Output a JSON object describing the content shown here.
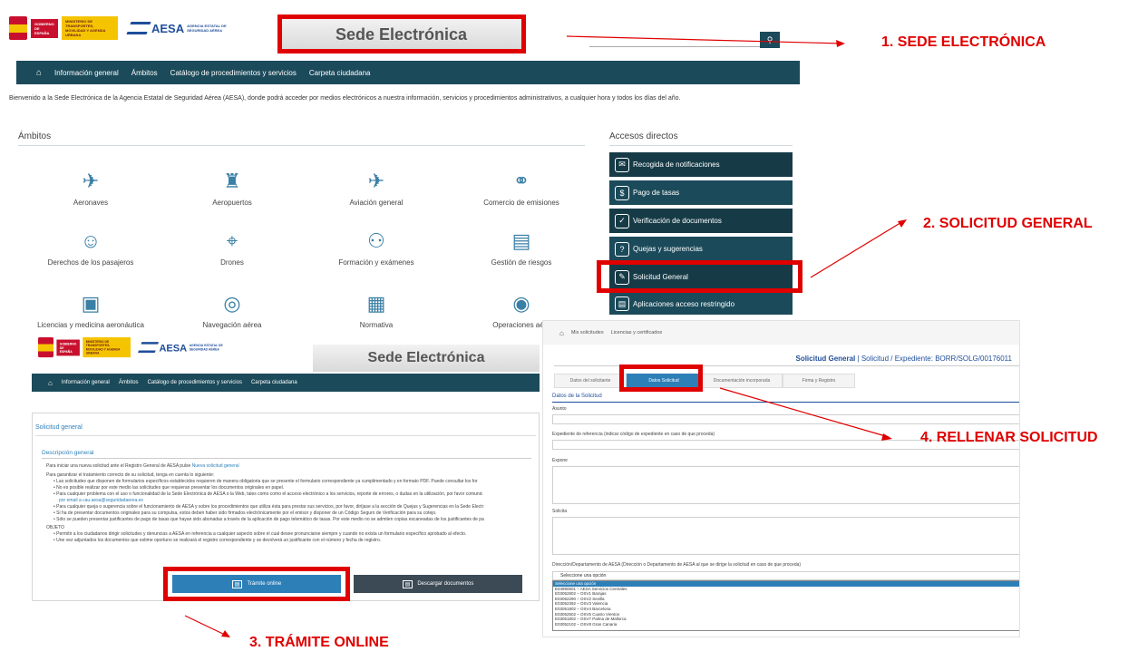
{
  "top": {
    "gov_text": "GOBIERNO DE ESPAÑA",
    "ministry_text": "MINISTERIO DE TRANSPORTES, MOVILIDAD Y AGENDA URBANA",
    "aesa": "AESA",
    "aesa_sub": "AGENCIA ESTATAL DE SEGURIDAD AÉREA",
    "banner": "Sede Electrónica",
    "nav": [
      "Información general",
      "Ámbitos",
      "Catálogo de procedimientos y servicios",
      "Carpeta ciudadana"
    ],
    "welcome": "Bienvenido a la Sede Electrónica de la Agencia Estatal de Seguridad Aérea (AESA), donde podrá acceder por medios electrónicos a nuestra información, servicios y procedimientos administrativos, a cualquier hora y todos los días del año.",
    "ambitos_title": "Ámbitos",
    "ambitos": [
      "Aeronaves",
      "Aeropuertos",
      "Aviación general",
      "Comercio de emisiones",
      "Derechos de los pasajeros",
      "Drones",
      "Formación y exámenes",
      "Gestión de riesgos",
      "Licencias y medicina aeronáutica",
      "Navegación aérea",
      "Normativa",
      "Operaciones aére"
    ],
    "accesos_title": "Accesos directos",
    "accesos": [
      "Recogida de notificaciones",
      "Pago de tasas",
      "Verificación de documentos",
      "Quejas y sugerencias",
      "Solicitud General",
      "Aplicaciones acceso restringido"
    ]
  },
  "annotations": {
    "a1": "1. SEDE ELECTRÓNICA",
    "a2": "2. SOLICITUD GENERAL",
    "a3": "3. TRÁMITE ONLINE",
    "a4": "4. RELLENAR SOLICITUD"
  },
  "bottom_left": {
    "title": "Solicitud general",
    "desc_title": "Descripción general",
    "intro_prefix": "Para iniciar una nueva solicitud ante el Registro General de AESA pulse",
    "intro_link": "Nueva solicitud general",
    "line2": "Para garantizar el tratamiento correcto de su solicitud, tenga en cuenta lo siguiente:",
    "bullets": [
      "Las solicitudes que disponen de formularios específicos establecidos requieren de manera obligatoria que se presente el formulario correspondiente ya cumplimentado y en formato PDF. Puede consultar los for",
      "No es posible realizar por este medio las solicitudes que requieran presentar los documentos originales en papel.",
      "Para cualquier problema con el uso o funcionalidad de la Sede Electrónica de AESA o la Web, tales como como el acceso electrónico a los servicios, reporte de errores, o dudas en la utilización, por favor comunic",
      "por email a cau.aesa@seguridadaerea.es",
      "Para cualquier queja o sugerencia sobre el funcionamiento de AESA y sobre los procedimientos que utiliza ésta para prestar sus servicios, por favor, diríjase a la sección de Quejas y Sugerencias en la Sede Electr",
      "Si ha de presentar documentos originales para su compulsa, estos deben haber sido firmados electrónicamente por el emisor y disponer de un Código Seguro de Verificación para su cotejo.",
      "Sólo se pueden presentar justificantes de pago de tasas que hayan sido abonadas a través de la aplicación de pago telemático de tasas. Por este medio no se admiten copias escaneadas de los justificantes de pa"
    ],
    "objeto": "OBJETO",
    "obj_bullets": [
      "Permitir a los ciudadanos dirigir solicitudes y denuncias a AESA en referencia a cualquier aspecto sobre el cual desee pronunciarse siempre y cuando no exista un formulario específico aprobado al efecto.",
      "Une vez adjuntados los documentos que estime oportuno se realizará el registro correspondiente y se devolverá un justificante con el número y fecha de registro."
    ],
    "btn_online": "Trámite online",
    "btn_download": "Descargar documentos"
  },
  "form": {
    "crumbs": [
      "Mis solicitudes",
      "Licencias y certificados"
    ],
    "heading_bold": "Solicitud General",
    "heading_rest": "| Solicitud / Expediente: BORR/SOLG/00176011",
    "steps": [
      "Datos del solicitante",
      "Datos Solicitud",
      "Documentación incorporada",
      "Firma y Registro"
    ],
    "section": "Datos de la Solicitud",
    "asunto": "Asunto",
    "expediente": "Expediente de referencia (indicar código de expediente en caso de que proceda)",
    "expone": "Expone",
    "solicita": "Solicita",
    "direccion": "Dirección/Departamento de AESA (Dirección o Departamento de AESA al que se dirige la solicitud en caso de que proceda)",
    "select_value": "Seleccione una opción",
    "options": [
      "Seleccione una opción",
      "E04990601 – AESA Servicios Centrales",
      "E03052802 – OSV1 Barajas",
      "E03052290 – OSV2 Sevilla",
      "E03052392 – OSV3 Valencia",
      "E03051802 – OSV4 Barcelona",
      "E03052502 – OSV5 Cuatro Vientos",
      "E03051802 – OSV7 Palma de Mallorca",
      "E03052102 – OSV8 Gran Canaria"
    ]
  }
}
